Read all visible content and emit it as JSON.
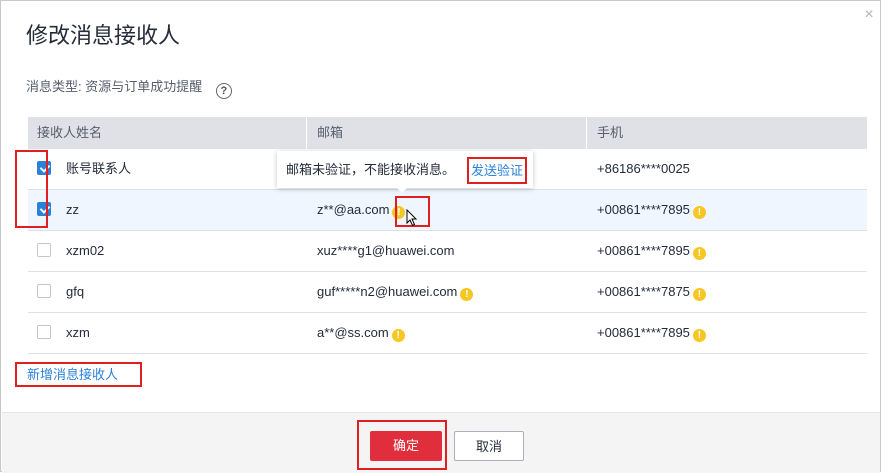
{
  "dialog": {
    "title": "修改消息接收人",
    "close_glyph": "×",
    "message_type_label": "消息类型: 资源与订单成功提醒",
    "help_glyph": "?"
  },
  "table": {
    "headers": [
      "接收人姓名",
      "邮箱",
      "手机"
    ],
    "rows": [
      {
        "checked": true,
        "name": "账号联系人",
        "email": "",
        "email_warn": false,
        "phone": "+86186****0025",
        "phone_warn": false
      },
      {
        "checked": true,
        "name": "zz",
        "email": "z**@aa.com",
        "email_warn": true,
        "phone": "+00861****7895",
        "phone_warn": true
      },
      {
        "checked": false,
        "name": "xzm02",
        "email": "xuz****g1@huawei.com",
        "email_warn": false,
        "phone": "+00861****7895",
        "phone_warn": true
      },
      {
        "checked": false,
        "name": "gfq",
        "email": "guf*****n2@huawei.com",
        "email_warn": true,
        "phone": "+00861****7875",
        "phone_warn": true
      },
      {
        "checked": false,
        "name": "xzm",
        "email": "a**@ss.com",
        "email_warn": true,
        "phone": "+00861****7895",
        "phone_warn": true
      }
    ]
  },
  "tooltip": {
    "message": "邮箱未验证，不能接收消息。",
    "verify_link": "发送验证"
  },
  "add_recipient_link": "新增消息接收人",
  "footer": {
    "confirm": "确定",
    "cancel": "取消"
  },
  "colors": {
    "primary": "#e02e3d",
    "link": "#2a81d9",
    "highlight_row": "#f0f6ff",
    "annotation": "#e02020",
    "warning": "#f6c623"
  },
  "icons": {
    "close": "close-icon",
    "help": "help-circle-icon",
    "warning": "warning-icon",
    "checkbox": "checkbox-icon"
  }
}
